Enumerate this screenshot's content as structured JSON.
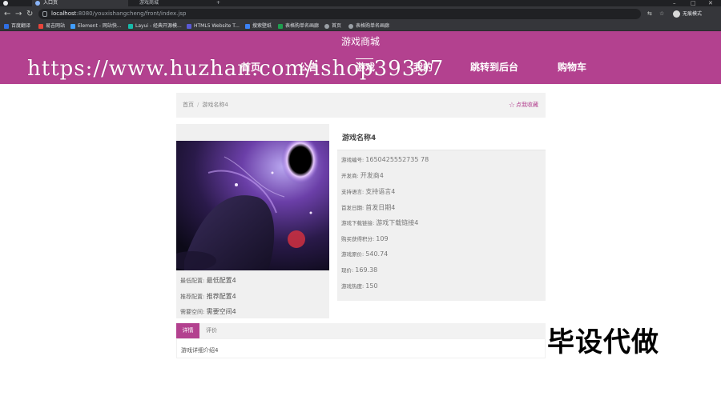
{
  "browser": {
    "tabs": [
      {
        "title": "入口页"
      },
      {
        "title": "游戏商城"
      }
    ],
    "new_tab": "+",
    "window_controls": [
      "–",
      "□",
      "✕"
    ],
    "url_host": "localhost",
    "url_path": ":8080/youxishangcheng/front/index.jsp",
    "profile_label": "无痕模式",
    "bookmarks": [
      {
        "label": "百度翻译",
        "color": "#2f6fe4"
      },
      {
        "label": "易吉网站",
        "color": "#e8443a"
      },
      {
        "label": "Element - 网站快...",
        "color": "#409eff"
      },
      {
        "label": "Layui - 经典开源模...",
        "color": "#16baaa"
      },
      {
        "label": "HTML5 Website T...",
        "color": "#5a5ad6"
      },
      {
        "label": "搜索壁纸",
        "color": "#3b82f6"
      },
      {
        "label": "表格购单名画廊",
        "color": "#1e9e4f"
      },
      {
        "label": "首页",
        "color": "#9aa0a6"
      },
      {
        "label": "表格购单名画廊",
        "color": "#9aa0a6"
      }
    ]
  },
  "site": {
    "title": "游戏商城",
    "nav": [
      "首页",
      "公告",
      "游戏",
      "我的",
      "跳转到后台",
      "购物车"
    ],
    "watermark_url": "https://www.huzhan.com/ishop39397"
  },
  "breadcrumb": {
    "home": "首页",
    "separator": "/",
    "current": "游戏名称4",
    "favorite_label": "点我收藏"
  },
  "game": {
    "image_alt": "game artwork",
    "configs": [
      {
        "label": "最低配置:",
        "value": "最低配置4"
      },
      {
        "label": "推荐配置:",
        "value": "推荐配置4"
      },
      {
        "label": "需要空间:",
        "value": "需要空间4"
      }
    ],
    "name": "游戏名称4",
    "details": [
      {
        "label": "游戏编号:",
        "value": "1650425552735 78"
      },
      {
        "label": "开发商:",
        "value": "开发商4"
      },
      {
        "label": "支持语言:",
        "value": "支持语言4"
      },
      {
        "label": "首发日期:",
        "value": "首发日期4"
      },
      {
        "label": "游戏下载链接:",
        "value": "游戏下载链接4"
      },
      {
        "label": "购买获得积分:",
        "value": "109"
      },
      {
        "label": "游戏原价:",
        "value": "540.74"
      },
      {
        "label": "现价:",
        "value": "169.38"
      },
      {
        "label": "游戏热度:",
        "value": "150"
      }
    ]
  },
  "tabs": {
    "active": "详情",
    "other": "评价",
    "content": "游戏详细介绍4"
  },
  "overlay_stamp": "毕设代做",
  "colors": {
    "brand": "#b3418f",
    "chrome_dark": "#202124",
    "chrome_mid": "#35363a"
  }
}
